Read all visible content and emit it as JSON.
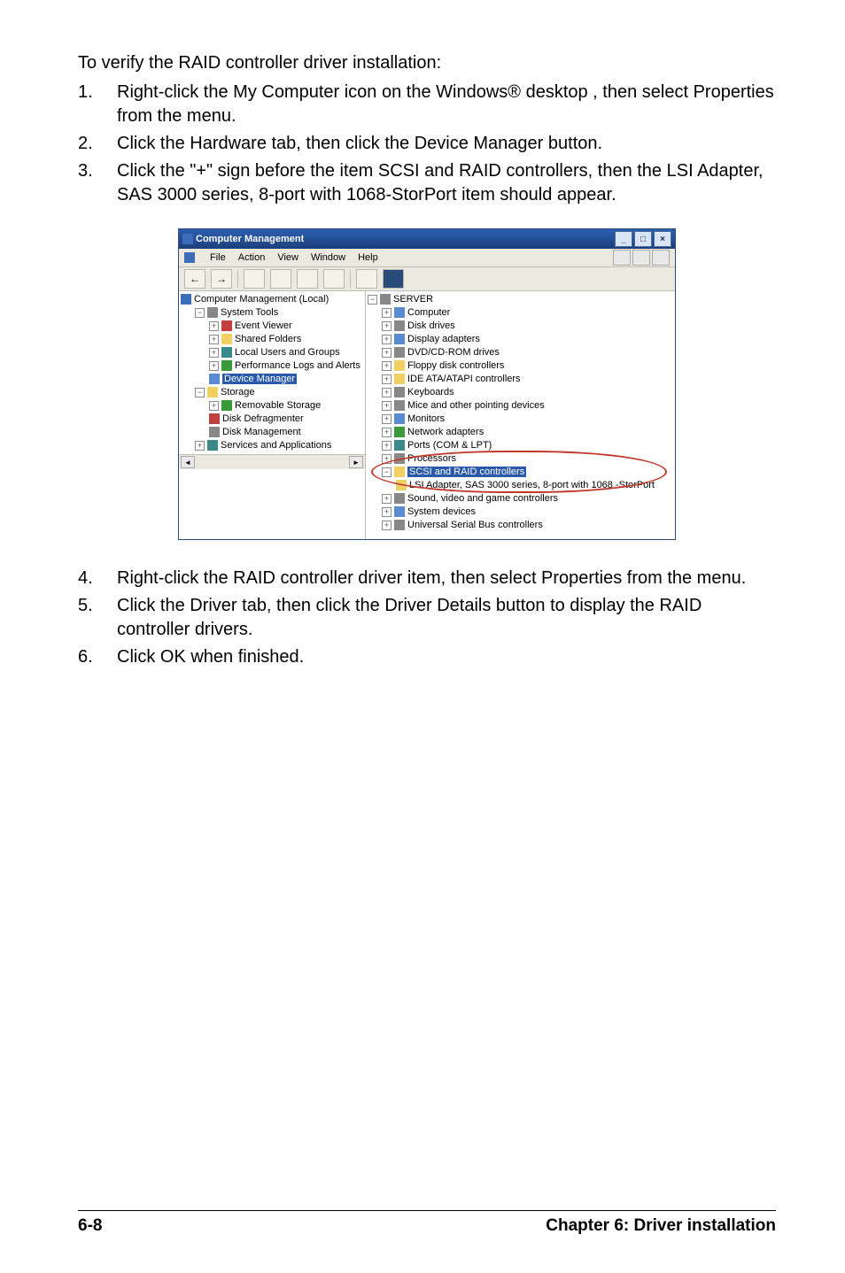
{
  "intro": "To verify the RAID controller driver installation:",
  "steps_top": [
    {
      "n": "1.",
      "t": "Right-click the My Computer icon on the Windows® desktop , then select Properties from the menu."
    },
    {
      "n": "2.",
      "t": "Click the Hardware tab, then click the Device Manager button."
    },
    {
      "n": "3.",
      "t": "Click the \"+\" sign before the item SCSI and RAID controllers, then the LSI Adapter, SAS 3000 series, 8-port with 1068-StorPort item should appear."
    }
  ],
  "steps_bottom": [
    {
      "n": "4.",
      "t": "Right-click the RAID controller driver item, then select Properties from the menu."
    },
    {
      "n": "5.",
      "t": "Click the Driver tab, then click the Driver Details button to display the RAID controller drivers."
    },
    {
      "n": "6.",
      "t": "Click OK when finished."
    }
  ],
  "window": {
    "title": "Computer Management",
    "menus": [
      "File",
      "Action",
      "View",
      "Window",
      "Help"
    ],
    "toolbar_glyphs": [
      "←",
      "→",
      "",
      "",
      "",
      "",
      "",
      ""
    ]
  },
  "left_tree": {
    "root": "Computer Management (Local)",
    "sys": "System Tools",
    "sys_items": [
      "Event Viewer",
      "Shared Folders",
      "Local Users and Groups",
      "Performance Logs and Alerts",
      "Device Manager"
    ],
    "storage": "Storage",
    "storage_items": [
      "Removable Storage",
      "Disk Defragmenter",
      "Disk Management"
    ],
    "services": "Services and Applications"
  },
  "right_tree": {
    "root": "SERVER",
    "items": [
      "Computer",
      "Disk drives",
      "Display adapters",
      "DVD/CD-ROM drives",
      "Floppy disk controllers",
      "IDE ATA/ATAPI controllers",
      "Keyboards",
      "Mice and other pointing devices",
      "Monitors",
      "Network adapters",
      "Ports (COM & LPT)",
      "Processors"
    ],
    "scsi": "SCSI and RAID controllers",
    "scsi_child": "LSI Adapter, SAS 3000 series, 8-port with 1068 -StorPort",
    "tail": [
      "Sound, video and game controllers",
      "System devices",
      "Universal Serial Bus controllers"
    ]
  },
  "footer": {
    "left": "6-8",
    "right": "Chapter 6: Driver installation"
  }
}
